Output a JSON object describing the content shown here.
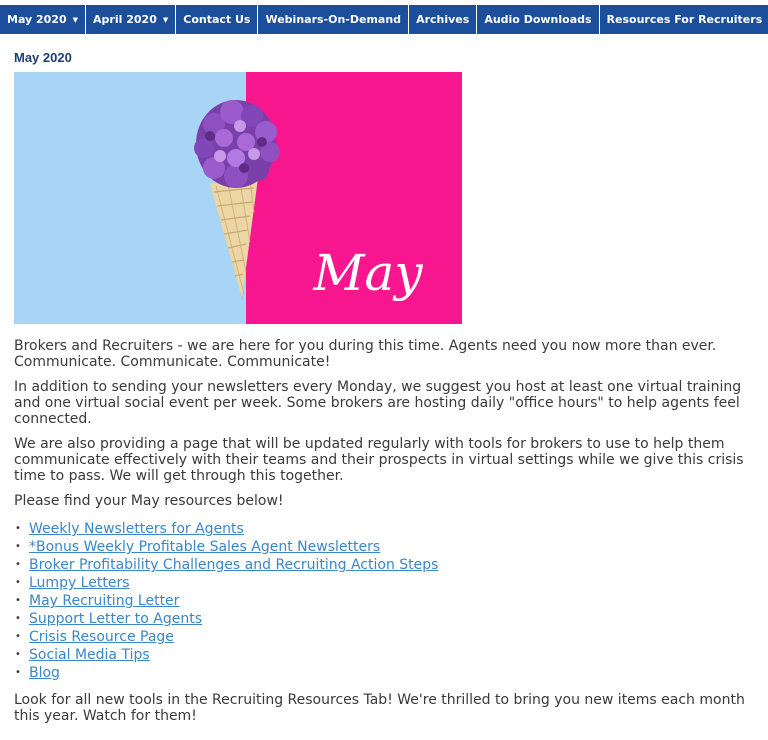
{
  "nav": {
    "items": [
      {
        "label": "May 2020",
        "dropdown": true
      },
      {
        "label": "April 2020",
        "dropdown": true
      },
      {
        "label": "Contact Us",
        "dropdown": false
      },
      {
        "label": "Webinars-On-Demand",
        "dropdown": false
      },
      {
        "label": "Archives",
        "dropdown": false
      },
      {
        "label": "Audio Downloads",
        "dropdown": false
      },
      {
        "label": "Resources For Recruiters",
        "dropdown": false
      }
    ],
    "caret": "▼"
  },
  "page": {
    "title": "May 2020"
  },
  "hero": {
    "text": "May",
    "colors": {
      "left": "#a8d4f5",
      "right": "#f7168e"
    }
  },
  "body": {
    "paragraphs": [
      "Brokers and Recruiters - we are here for you during this time. Agents need you now more than ever. Communicate. Communicate. Communicate!",
      "In addition to sending your newsletters every Monday, we suggest you host at least one virtual training and one virtual social event per week. Some brokers are hosting daily \"office hours\" to help agents feel connected.",
      "We are also providing a page that will be updated regularly with tools for brokers to use to help them communicate effectively with their teams and their prospects in virtual settings while we give this crisis time to pass. We will get through this together.",
      "Please find your May resources below!"
    ],
    "links": [
      "Weekly Newsletters for Agents",
      "*Bonus Weekly Profitable Sales Agent Newsletters ",
      "Broker Profitability Challenges and Recruiting Action Steps",
      "Lumpy Letters",
      "May Recruiting Letter",
      "Support Letter to Agents",
      "Crisis Resource Page",
      "Social Media Tips ",
      "Blog "
    ],
    "bullet": "•",
    "closing": "Look for all new tools in the Recruiting Resources Tab! We're thrilled to bring you new items each month this year. Watch for them!"
  }
}
